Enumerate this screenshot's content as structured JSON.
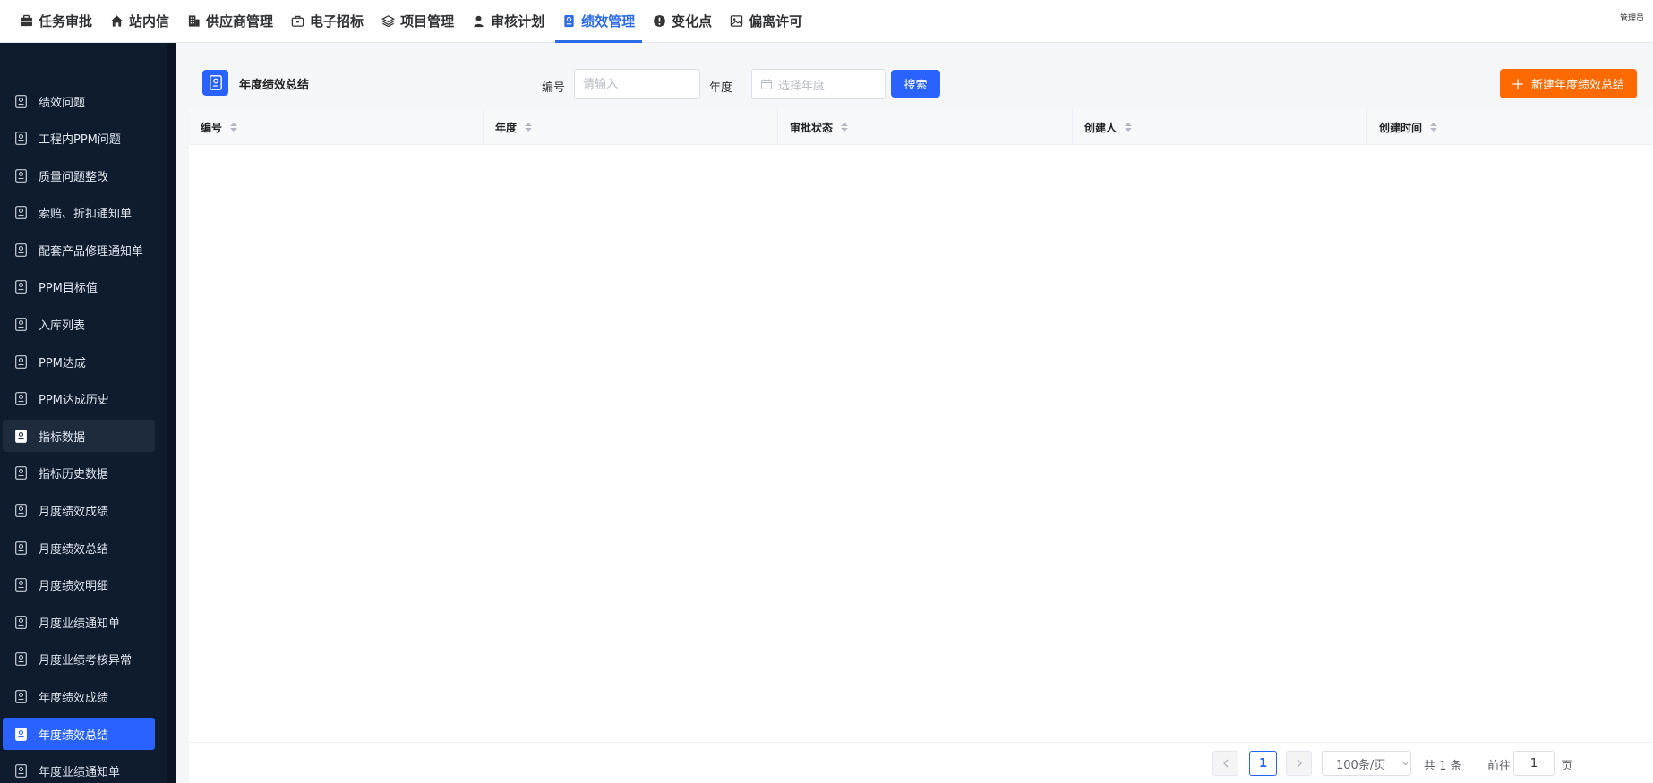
{
  "nav": {
    "items": [
      {
        "label": "任务审批",
        "icon": "briefcase-icon"
      },
      {
        "label": "站内信",
        "icon": "home-icon"
      },
      {
        "label": "供应商管理",
        "icon": "building-icon"
      },
      {
        "label": "电子招标",
        "icon": "case-icon"
      },
      {
        "label": "项目管理",
        "icon": "layers-icon"
      },
      {
        "label": "审核计划",
        "icon": "person-icon"
      },
      {
        "label": "绩效管理",
        "icon": "badge-icon",
        "active": true
      },
      {
        "label": "变化点",
        "icon": "alert-icon"
      },
      {
        "label": "偏离许可",
        "icon": "image-icon"
      }
    ],
    "user": "管理员"
  },
  "sidebar": {
    "items": [
      {
        "label": "绩效问题"
      },
      {
        "label": "工程内PPM问题"
      },
      {
        "label": "质量问题整改"
      },
      {
        "label": "索赔、折扣通知单"
      },
      {
        "label": "配套产品修理通知单"
      },
      {
        "label": "PPM目标值"
      },
      {
        "label": "入库列表"
      },
      {
        "label": "PPM达成"
      },
      {
        "label": "PPM达成历史"
      },
      {
        "label": "指标数据",
        "state": "hover"
      },
      {
        "label": "指标历史数据"
      },
      {
        "label": "月度绩效成绩"
      },
      {
        "label": "月度绩效总结"
      },
      {
        "label": "月度绩效明细"
      },
      {
        "label": "月度业绩通知单"
      },
      {
        "label": "月度业绩考核异常"
      },
      {
        "label": "年度绩效成绩"
      },
      {
        "label": "年度绩效总结",
        "state": "active"
      },
      {
        "label": "年度业绩通知单"
      }
    ]
  },
  "page": {
    "title": "年度绩效总结",
    "filters": {
      "code_label": "编号",
      "code_placeholder": "请输入",
      "year_label": "年度",
      "year_placeholder": "选择年度"
    },
    "search_button": "搜索",
    "create_button": "新建年度绩效总结"
  },
  "table": {
    "columns": [
      "编号",
      "年度",
      "审批状态",
      "创建人",
      "创建时间"
    ],
    "rows": []
  },
  "pagination": {
    "current_page": "1",
    "page_size": "100条/页",
    "total": "共 1 条",
    "goto_prefix": "前往",
    "goto_value": "1",
    "goto_suffix": "页"
  },
  "colors": {
    "primary": "#2962ff",
    "accent_orange": "#ff6a00",
    "sidebar_bg": "#0f1c2e"
  }
}
